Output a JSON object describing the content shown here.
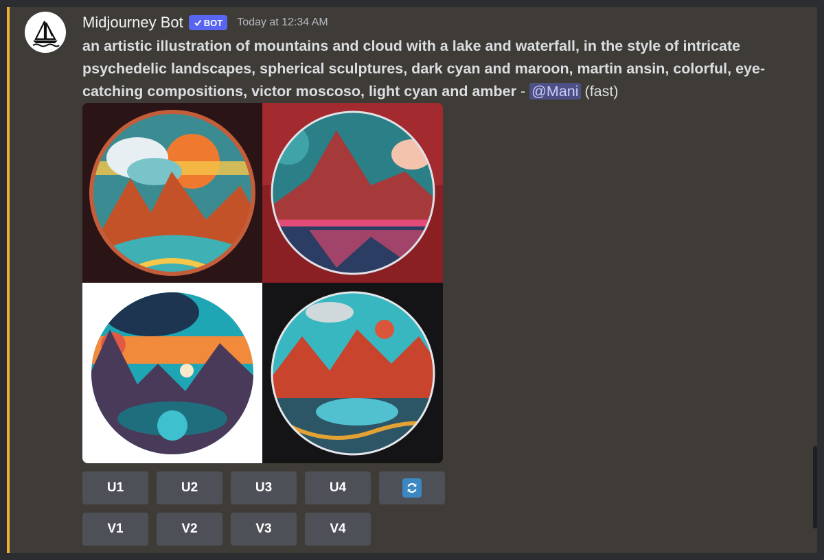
{
  "author": {
    "name": "Midjourney Bot",
    "badge": "BOT",
    "timestamp": "Today at 12:34 AM",
    "avatar_icon": "sailboat-icon"
  },
  "message": {
    "prompt": "an artistic illustration of mountains and cloud with a lake and waterfall, in the style of intricate psychedelic landscapes, spherical sculptures, dark cyan and maroon, martin ansin, colorful, eye-catching compositions, victor moscoso, light cyan and amber",
    "separator": " - ",
    "mention": "@Mani",
    "speed": "(fast)"
  },
  "images": [
    {
      "bg": "#2a1416",
      "sky": "#ef7a2f",
      "accent": "#f6c74a"
    },
    {
      "bg": "#8a1f24",
      "sky": "#2b7f86",
      "accent": "#e34b79"
    },
    {
      "bg": "#ffffff",
      "sky": "#1fa6b4",
      "accent": "#f28a3b"
    },
    {
      "bg": "#141316",
      "sky": "#39b7c1",
      "accent": "#d9563a"
    }
  ],
  "buttons": {
    "upscale": [
      "U1",
      "U2",
      "U3",
      "U4"
    ],
    "variation": [
      "V1",
      "V2",
      "V3",
      "V4"
    ],
    "reroll_icon": "refresh-icon"
  },
  "colors": {
    "accent_bar": "#f0b232",
    "bot_badge": "#5865f2",
    "mention_bg": "#4e5085",
    "button_bg": "#4e5058"
  }
}
